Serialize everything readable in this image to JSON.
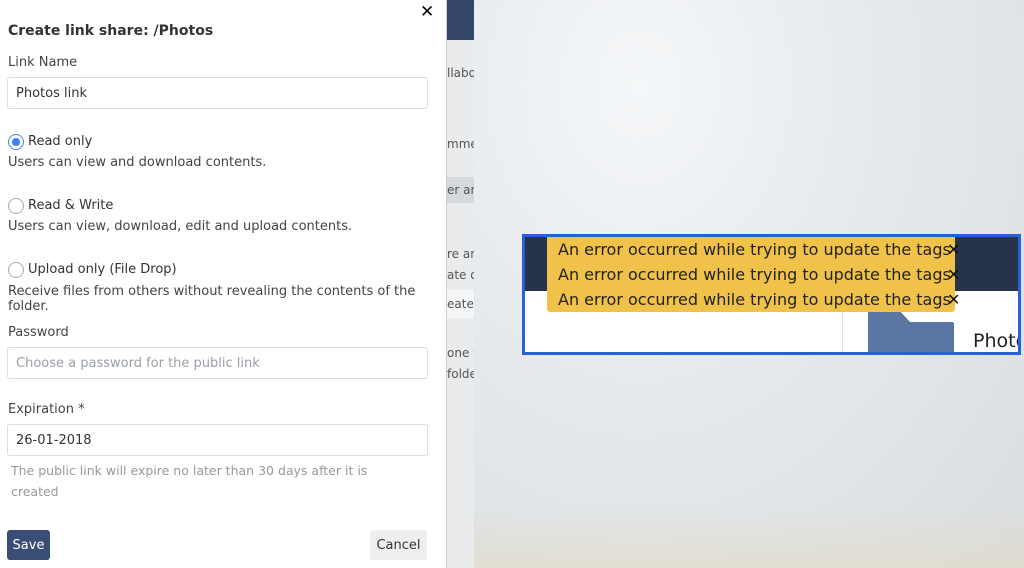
{
  "modal": {
    "title": "Create link share: /Photos",
    "close_glyph": "✕",
    "link_name": {
      "label": "Link Name",
      "value": "Photos link"
    },
    "permissions": [
      {
        "label": "Read only",
        "description": "Users can view and download contents.",
        "selected": true
      },
      {
        "label": "Read & Write",
        "description": "Users can view, download, edit and upload contents.",
        "selected": false
      },
      {
        "label": "Upload only (File Drop)",
        "description": "Receive files from others without revealing the contents of the folder.",
        "selected": false
      }
    ],
    "password": {
      "label": "Password",
      "placeholder": "Choose a password for the public link"
    },
    "expiration": {
      "label": "Expiration *",
      "value": "26-01-2018",
      "hint": "The public link will expire no later than 30 days after it is created"
    },
    "save_label": "Save",
    "cancel_label": "Cancel"
  },
  "background_fragments": [
    "llabo",
    "mme",
    "er an",
    "re ar",
    "ate o",
    "eate",
    "one v",
    "folde"
  ],
  "notifications": [
    {
      "text": "An error occurred while trying to update the tags",
      "close_glyph": "✕"
    },
    {
      "text": "An error occurred while trying to update the tags",
      "close_glyph": "✕"
    },
    {
      "text": "An error occurred while trying to update the tags",
      "close_glyph": "✕"
    }
  ],
  "folder_label": "Photo",
  "colors": {
    "accent": "#3b82f6",
    "primary_button": "#3a4e75",
    "toast": "#f0c24a",
    "highlight_border": "#2860d8"
  }
}
